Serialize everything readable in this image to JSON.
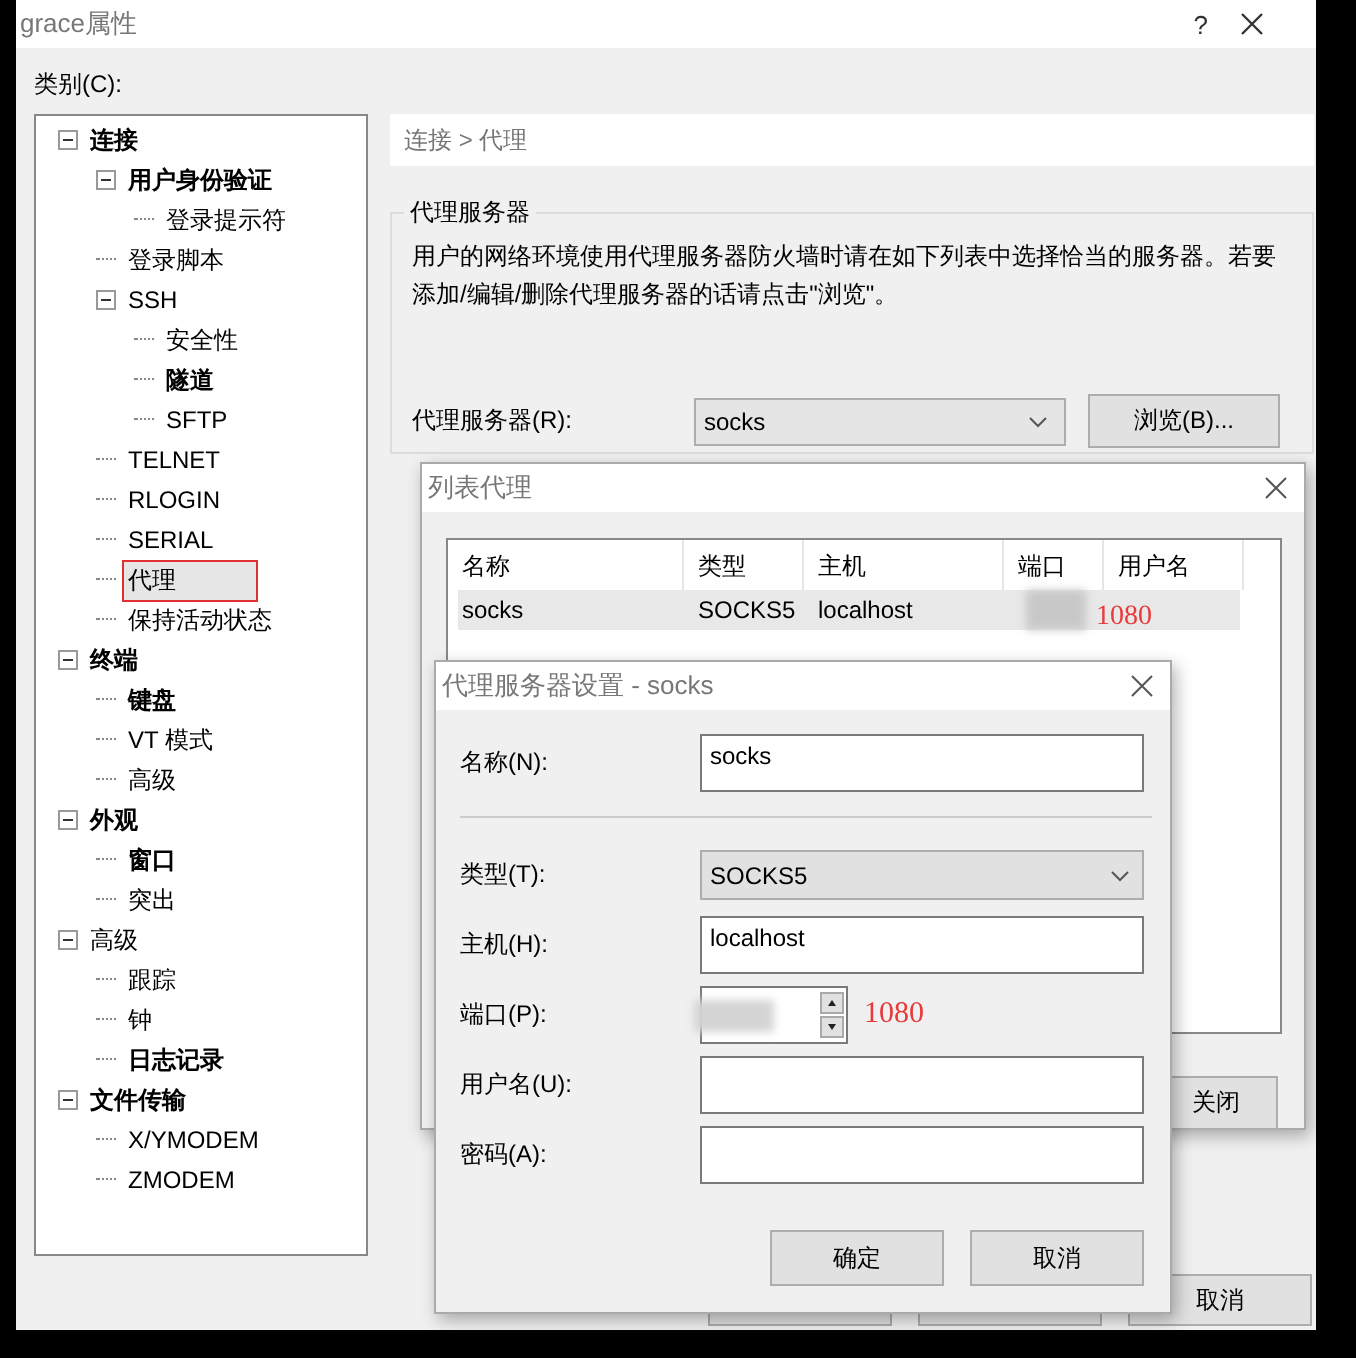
{
  "main_window": {
    "title": "grace属性",
    "help": "?"
  },
  "category_label": "类别(C):",
  "tree": [
    {
      "label": "连接",
      "bold": true,
      "selected": false,
      "expanded": true,
      "children": [
        {
          "label": "用户身份验证",
          "bold": true,
          "selected": false,
          "expanded": true,
          "children": [
            {
              "label": "登录提示符",
              "bold": false,
              "selected": false
            }
          ]
        },
        {
          "label": "登录脚本",
          "bold": false,
          "selected": false
        },
        {
          "label": "SSH",
          "bold": false,
          "selected": false,
          "expanded": true,
          "children": [
            {
              "label": "安全性",
              "bold": false,
              "selected": false
            },
            {
              "label": "隧道",
              "bold": true,
              "selected": false
            },
            {
              "label": "SFTP",
              "bold": false,
              "selected": false
            }
          ]
        },
        {
          "label": "TELNET",
          "bold": false,
          "selected": false
        },
        {
          "label": "RLOGIN",
          "bold": false,
          "selected": false
        },
        {
          "label": "SERIAL",
          "bold": false,
          "selected": false
        },
        {
          "label": "代理",
          "bold": false,
          "selected": true
        },
        {
          "label": "保持活动状态",
          "bold": false,
          "selected": false
        }
      ]
    },
    {
      "label": "终端",
      "bold": true,
      "selected": false,
      "expanded": true,
      "children": [
        {
          "label": "键盘",
          "bold": true,
          "selected": false
        },
        {
          "label": "VT 模式",
          "bold": false,
          "selected": false
        },
        {
          "label": "高级",
          "bold": false,
          "selected": false
        }
      ]
    },
    {
      "label": "外观",
      "bold": true,
      "selected": false,
      "expanded": true,
      "children": [
        {
          "label": "窗口",
          "bold": true,
          "selected": false
        },
        {
          "label": "突出",
          "bold": false,
          "selected": false
        }
      ]
    },
    {
      "label": "高级",
      "bold": false,
      "selected": false,
      "expanded": true,
      "children": [
        {
          "label": "跟踪",
          "bold": false,
          "selected": false
        },
        {
          "label": "钟",
          "bold": false,
          "selected": false
        },
        {
          "label": "日志记录",
          "bold": true,
          "selected": false
        }
      ]
    },
    {
      "label": "文件传输",
      "bold": true,
      "selected": false,
      "expanded": true,
      "children": [
        {
          "label": "X/YMODEM",
          "bold": false,
          "selected": false
        },
        {
          "label": "ZMODEM",
          "bold": false,
          "selected": false
        }
      ]
    }
  ],
  "breadcrumb": "连接 > 代理",
  "proxy_group": {
    "title": "代理服务器",
    "description": "用户的网络环境使用代理服务器防火墙时请在如下列表中选择恰当的服务器。若要添加/编辑/删除代理服务器的话请点击\"浏览\"。",
    "field_label": "代理服务器(R):",
    "value": "socks",
    "browse_button": "浏览(B)..."
  },
  "main_buttons": [
    "取消"
  ],
  "list_dialog": {
    "title": "列表代理",
    "columns": [
      "名称",
      "类型",
      "主机",
      "端口",
      "用户名"
    ],
    "rows": [
      {
        "cells": [
          "socks",
          "SOCKS5",
          "localhost"
        ],
        "port_note": "1080",
        "selected": true
      }
    ],
    "close_button": "关闭"
  },
  "settings_dialog": {
    "title": "代理服务器设置 - socks",
    "fields": [
      {
        "kind": "text",
        "label": "名称(N):",
        "value": "socks"
      },
      {
        "kind": "divider"
      },
      {
        "kind": "select",
        "label": "类型(T):",
        "value": "SOCKS5"
      },
      {
        "kind": "text",
        "label": "主机(H):",
        "value": "localhost"
      },
      {
        "kind": "spin",
        "label": "端口(P):",
        "note": "1080"
      },
      {
        "kind": "text",
        "label": "用户名(U):"
      },
      {
        "kind": "password",
        "label": "密码(A):"
      }
    ],
    "buttons": [
      "确定",
      "取消"
    ]
  }
}
